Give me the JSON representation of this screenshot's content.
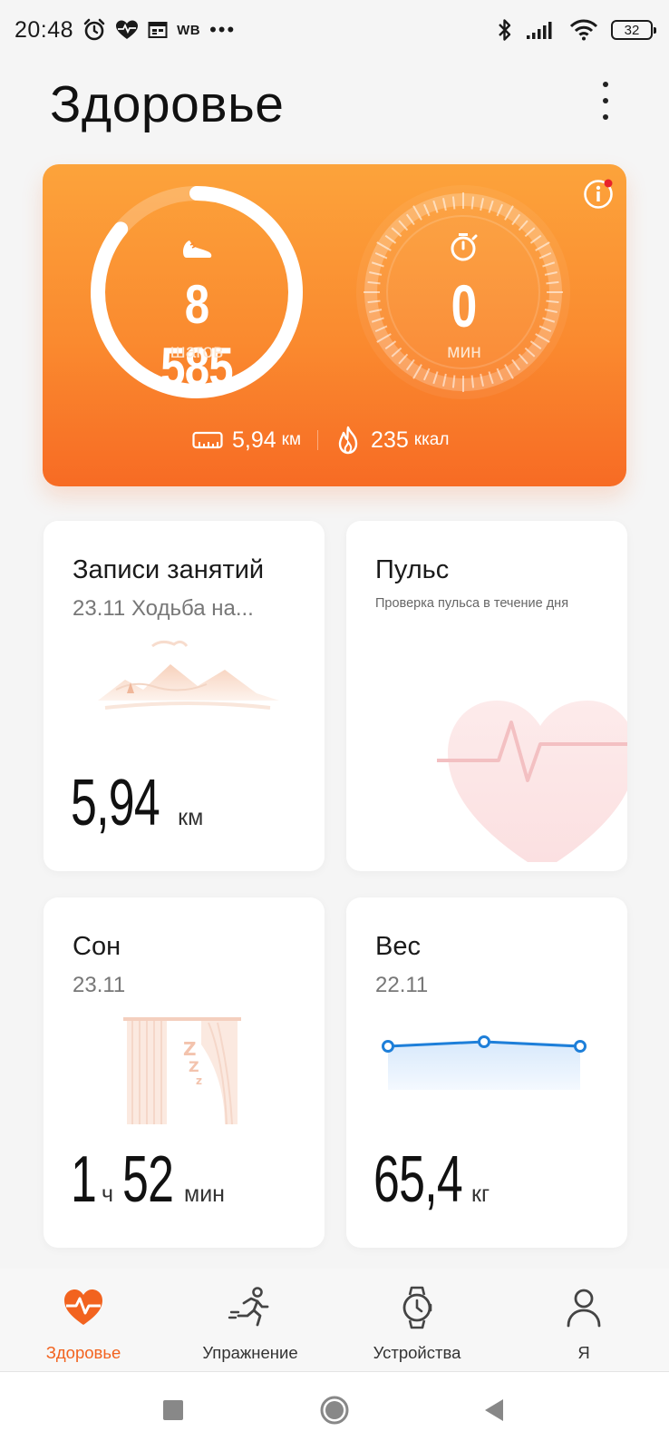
{
  "status_bar": {
    "time": "20:48",
    "carrier_tag": "WB",
    "more_indicator": "•••",
    "battery_level": "32",
    "icons": [
      "alarm-icon",
      "heart-rate-icon",
      "calendar-icon",
      "bluetooth-icon",
      "signal-icon",
      "wifi-icon",
      "battery-icon"
    ]
  },
  "header": {
    "title": "Здоровье"
  },
  "activity": {
    "steps_value": "8 585",
    "steps_label": "шагов",
    "steps_progress": 0.86,
    "minutes_value": "0",
    "minutes_label": "мин",
    "distance_value": "5,94",
    "distance_unit": "км",
    "calories_value": "235",
    "calories_unit": "ккал",
    "accent_color": "#f97b2c"
  },
  "tiles": {
    "workouts": {
      "title": "Записи занятий",
      "subtitle": "23.11 Ходьба на...",
      "value": "5,94",
      "unit": "км"
    },
    "pulse": {
      "title": "Пульс",
      "note": "Проверка пульса в течение дня"
    },
    "sleep": {
      "title": "Сон",
      "date": "23.11",
      "hours": "1",
      "hours_unit": "ч",
      "minutes": "52",
      "minutes_unit": "мин"
    },
    "weight": {
      "title": "Вес",
      "date": "22.11",
      "value": "65,4",
      "unit": "кг",
      "line_color": "#1e7fd9"
    }
  },
  "bottom_nav": {
    "items": [
      {
        "label": "Здоровье",
        "icon": "heart-pulse-icon",
        "active": true
      },
      {
        "label": "Упражнение",
        "icon": "running-person-icon",
        "active": false
      },
      {
        "label": "Устройства",
        "icon": "smartwatch-icon",
        "active": false
      },
      {
        "label": "Я",
        "icon": "person-icon",
        "active": false
      }
    ],
    "active_color": "#f2631f"
  },
  "system_nav": {
    "buttons": [
      "recents-button",
      "home-button",
      "back-button"
    ]
  }
}
